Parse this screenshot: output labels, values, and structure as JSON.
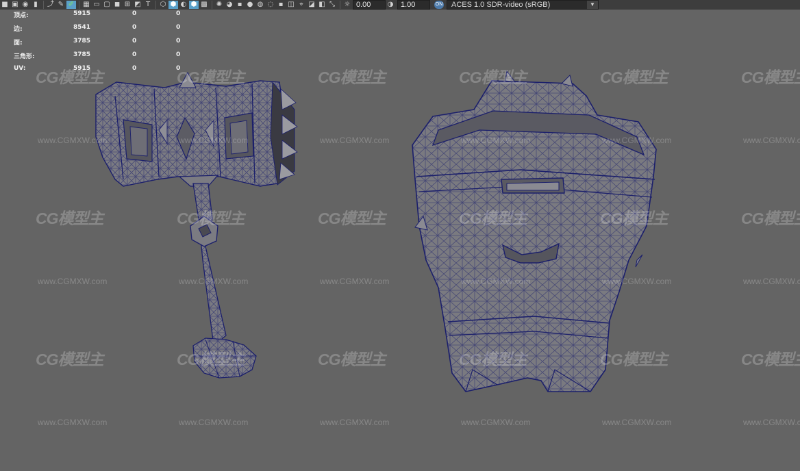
{
  "toolbar": {
    "icons_left": [
      "camera-icon",
      "bookmark-camera-icon",
      "camera-attributes-icon",
      "image-plane-icon",
      "select-camera-icon",
      "paint-select-icon",
      "grease-pencil-icon"
    ],
    "icons_mid": [
      "grid-icon",
      "film-gate-icon",
      "resolution-gate-icon",
      "gate-mask-icon",
      "field-chart-icon",
      "safe-action-icon",
      "safe-title-icon",
      "wireframe-icon",
      "smooth-shade-icon",
      "default-material-icon",
      "wireframe-on-shaded-icon",
      "textured-icon",
      "use-all-lights-icon",
      "shadows-icon",
      "screen-space-ao-icon",
      "motion-blur-icon",
      "multisample-aa-icon",
      "depth-of-field-icon",
      "isolate-select-icon",
      "xray-icon",
      "xray-joints-icon",
      "xray-active-components-icon",
      "backface-culling-icon"
    ],
    "exposure_icon": "exposure-icon",
    "exposure_value": "0.00",
    "gamma_icon": "gamma-icon",
    "gamma_value": "1.00",
    "colormanagement_badge": "ON",
    "colorspace": "ACES 1.0 SDR-video (sRGB)",
    "dropdown_icon": "chevron-down-icon"
  },
  "hud": {
    "rows": [
      {
        "label": "顶点:",
        "v1": "5915",
        "v2": "0",
        "v3": "0"
      },
      {
        "label": "边:",
        "v1": "8541",
        "v2": "0",
        "v3": "0"
      },
      {
        "label": "面:",
        "v1": "3785",
        "v2": "0",
        "v3": "0"
      },
      {
        "label": "三角形:",
        "v1": "3785",
        "v2": "0",
        "v3": "0"
      },
      {
        "label": "UV:",
        "v1": "5915",
        "v2": "0",
        "v3": "0"
      }
    ]
  },
  "watermark": {
    "logo": "CG模型主",
    "url": "www.CGMXW.com"
  },
  "viewport": {
    "background_color": "#646464",
    "mesh_fill_color": "#7a7a80",
    "wireframe_color": "#1b1f6b",
    "objects": [
      "hammer-wireframe-mesh",
      "hammer-head-wireframe-mesh"
    ]
  }
}
